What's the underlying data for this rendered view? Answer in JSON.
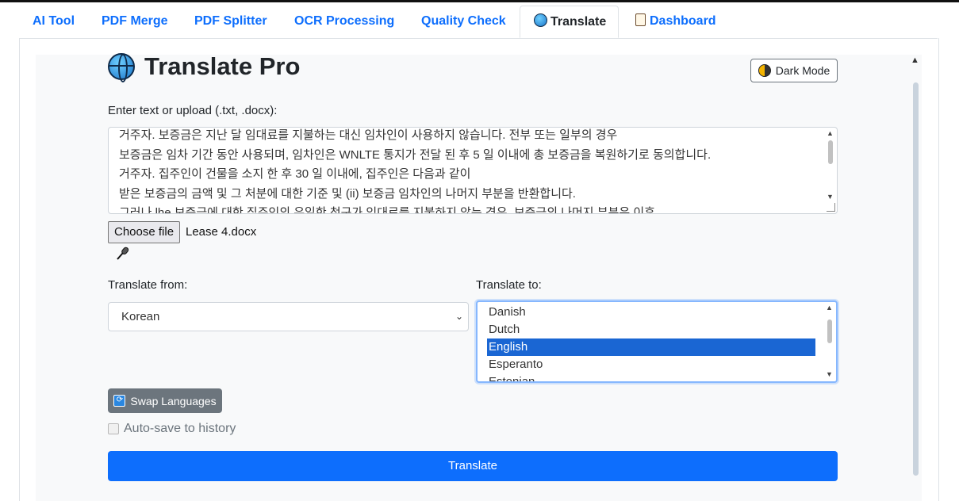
{
  "tabs": [
    {
      "label": "AI Tool"
    },
    {
      "label": "PDF Merge"
    },
    {
      "label": "PDF Splitter"
    },
    {
      "label": "OCR Processing"
    },
    {
      "label": "Quality Check"
    },
    {
      "label": "Translate",
      "icon": "globe-icon",
      "active": true
    },
    {
      "label": "Dashboard",
      "icon": "clipboard-icon"
    }
  ],
  "header": {
    "title": "Translate Pro",
    "dark_mode_label": "Dark Mode"
  },
  "input": {
    "label": "Enter text or upload (.txt, .docx):",
    "lines": [
      "거주자. 보증금은 지난 달 임대료를 지불하는 대신 임차인이 사용하지 않습니다. 전부 또는 일부의 경우",
      "보증금은 임차 기간 동안 사용되며, 임차인은 WNLTE 통지가 전달 된 후 5 일 이내에 총 보증금을 복원하기로 동의합니다.",
      "거주자. 집주인이 건물을 소지 한 후 30 일 이내에, 집주인은 다음과 같이",
      "받은 보증금의 금액 및 그 처분에 대한 기준 및 (ii) 보증금 임차인의 나머지 부분을 반환합니다.",
      "그러나 lhe 보증금에 대한 집주인의 유일한 청구가 임대료를 지불하지 않는 경우, 보증금의 나머지 부분은 이후"
    ],
    "file_button": "Choose file",
    "file_name": "Lease 4.docx"
  },
  "from": {
    "label": "Translate from:",
    "selected": "Korean"
  },
  "to": {
    "label": "Translate to:",
    "options": [
      "Danish",
      "Dutch",
      "English",
      "Esperanto",
      "Estonian"
    ],
    "selected": "English"
  },
  "swap_label": "Swap Languages",
  "autosave_label": "Auto-save to history",
  "translate_label": "Translate",
  "colors": {
    "primary": "#0d6efd",
    "secondary": "#6c757d",
    "selection": "#1a66d3"
  }
}
